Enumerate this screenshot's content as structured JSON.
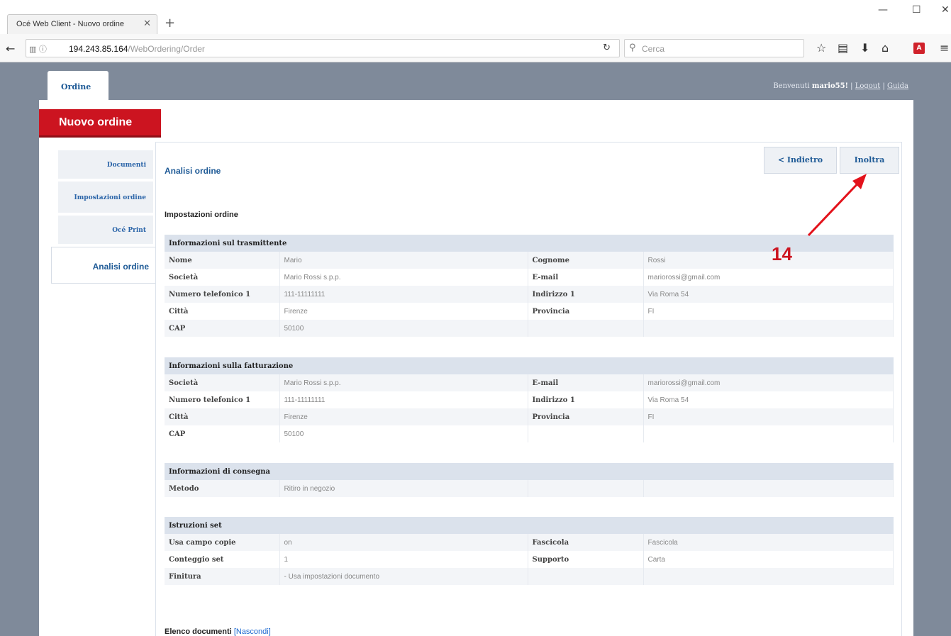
{
  "browser": {
    "tab_title": "Océ Web Client - Nuovo ordine",
    "url_host": "194.243.85.164",
    "url_path": "/WebOrdering/Order",
    "search_placeholder": "Cerca"
  },
  "app": {
    "top_tab": "Ordine",
    "welcome_prefix": "Benvenuti",
    "username": "mario55",
    "logout": "Logout",
    "help": "Guida",
    "banner": "Nuovo ordine"
  },
  "steps": [
    {
      "label": "Documenti"
    },
    {
      "label": "Impostazioni ordine"
    },
    {
      "label": "Océ Print"
    },
    {
      "label": "Analisi ordine"
    }
  ],
  "main": {
    "title": "Analisi ordine",
    "back_button": "< Indietro",
    "forward_button": "Inoltra",
    "section_title": "Impostazioni ordine",
    "annotation": "14",
    "doc_list_title": "Elenco documenti",
    "doc_list_toggle": "[Nascondi]"
  },
  "tables": {
    "sender": {
      "title": "Informazioni sul trasmittente",
      "rows": [
        [
          "Nome",
          "Mario",
          "Cognome",
          "Rossi"
        ],
        [
          "Società",
          "Mario Rossi s.p.p.",
          "E-mail",
          "mariorossi@gmail.com"
        ],
        [
          "Numero telefonico 1",
          "111-11111111",
          "Indirizzo 1",
          "Via Roma 54"
        ],
        [
          "Città",
          "Firenze",
          "Provincia",
          "FI"
        ],
        [
          "CAP",
          "50100",
          "",
          ""
        ]
      ]
    },
    "billing": {
      "title": "Informazioni sulla fatturazione",
      "rows": [
        [
          "Società",
          "Mario Rossi s.p.p.",
          "E-mail",
          "mariorossi@gmail.com"
        ],
        [
          "Numero telefonico 1",
          "111-11111111",
          "Indirizzo 1",
          "Via Roma 54"
        ],
        [
          "Città",
          "Firenze",
          "Provincia",
          "FI"
        ],
        [
          "CAP",
          "50100",
          "",
          ""
        ]
      ]
    },
    "delivery": {
      "title": "Informazioni di consegna",
      "rows": [
        [
          "Metodo",
          "Ritiro in negozio",
          "",
          ""
        ]
      ]
    },
    "set": {
      "title": "Istruzioni set",
      "rows": [
        [
          "Usa campo copie",
          "on",
          "Fascicola",
          "Fascicola"
        ],
        [
          "Conteggio set",
          "1",
          "Supporto",
          "Carta"
        ],
        [
          "Finitura",
          "- Usa impostazioni documento",
          "",
          ""
        ]
      ]
    }
  }
}
